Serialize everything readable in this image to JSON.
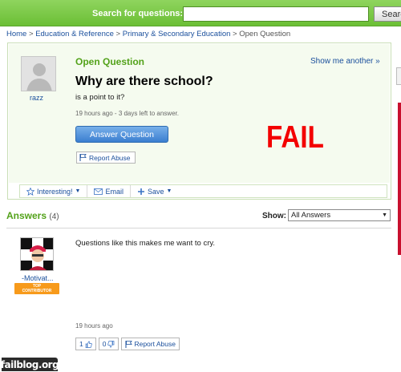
{
  "search": {
    "label": "Search for questions:",
    "value": "",
    "button": "Search"
  },
  "breadcrumb": [
    "Home",
    "Education & Reference",
    "Primary & Secondary Education",
    "Open Question"
  ],
  "breadcrumb_sep": ">",
  "question": {
    "asker": "razz",
    "status": "Open Question",
    "show_another": "Show me another »",
    "title": "Why are there school?",
    "detail": "is a point to it?",
    "time": "19 hours ago - 3 days left to answer.",
    "answer_button": "Answer Question",
    "report_abuse": "Report Abuse",
    "actions": [
      {
        "label": "Interesting!",
        "icon": "star-icon",
        "dropdown": true
      },
      {
        "label": "Email",
        "icon": "envelope-icon",
        "dropdown": false
      },
      {
        "label": "Save",
        "icon": "plus-icon",
        "dropdown": true
      }
    ]
  },
  "overlay": {
    "fail_text": "FAIL",
    "color": "#f30000"
  },
  "answers": {
    "heading": "Answers",
    "count": "(4)",
    "show_label": "Show:",
    "filter": "All Answers",
    "items": [
      {
        "author": "-Motivat...",
        "badge_line1": "TOP",
        "badge_line2": "CONTRIBUTOR",
        "text": "Questions like this makes me want to cry.",
        "time": "19 hours ago",
        "thumbs_up": "1",
        "thumbs_down": "0",
        "report_abuse": "Report Abuse"
      }
    ]
  },
  "watermark": "failblog.org",
  "colors": {
    "topbar": "#7ac943",
    "link": "#1a4f9c",
    "status_green": "#53a21a",
    "answer_button": "#3b7ed0"
  }
}
